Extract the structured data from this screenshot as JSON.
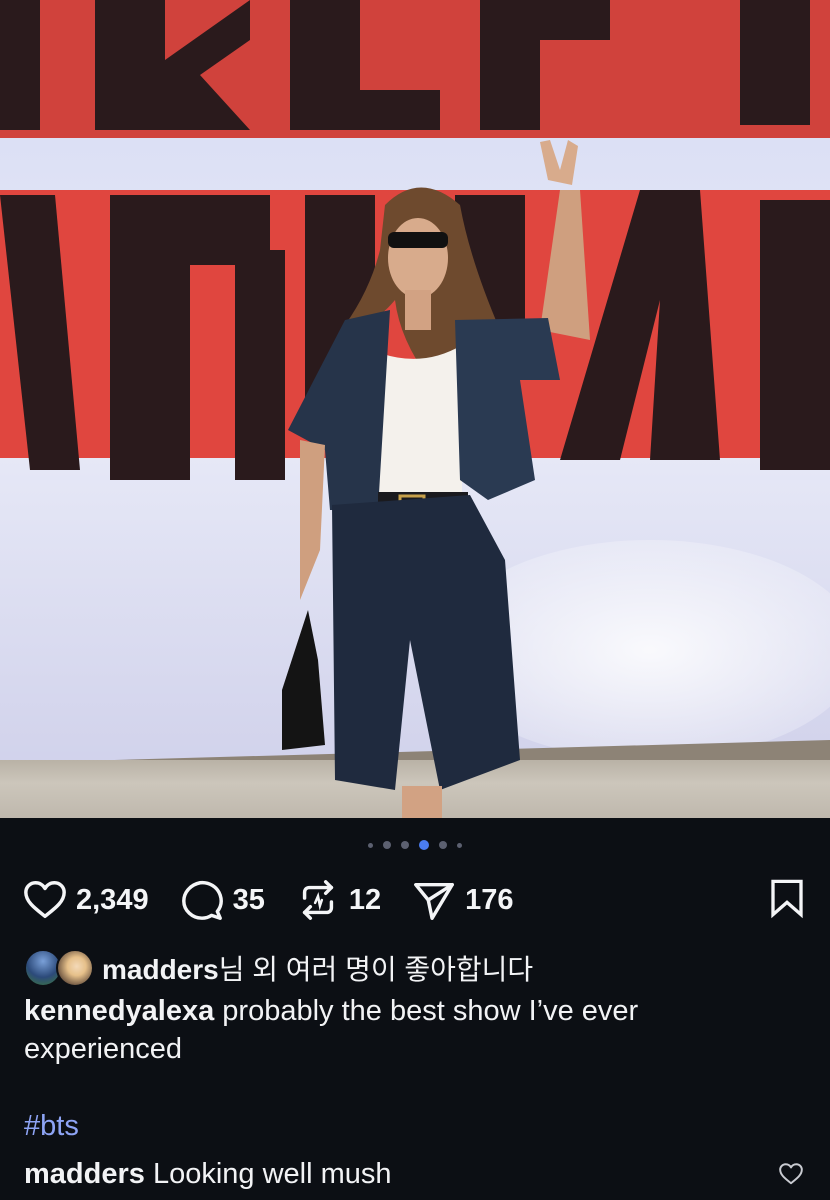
{
  "post": {
    "media": {
      "carousel": {
        "count": 5,
        "active_index": 2
      }
    },
    "actions": {
      "likes": "2,349",
      "comments": "35",
      "reposts": "12",
      "shares": "176"
    },
    "liked_by": {
      "user": "madders",
      "suffix": "님 외 여러 명이 좋아합니다"
    },
    "caption": {
      "user": "kennedyalexa",
      "text": " probably the best show I’ve ever experienced"
    },
    "hashtag": "#bts",
    "comment": {
      "user": "madders",
      "text": " Looking well mush"
    }
  },
  "colors": {
    "background": "#0c0f14",
    "hashtag": "#8ea4f5",
    "active_dot": "#4a7cf0"
  }
}
